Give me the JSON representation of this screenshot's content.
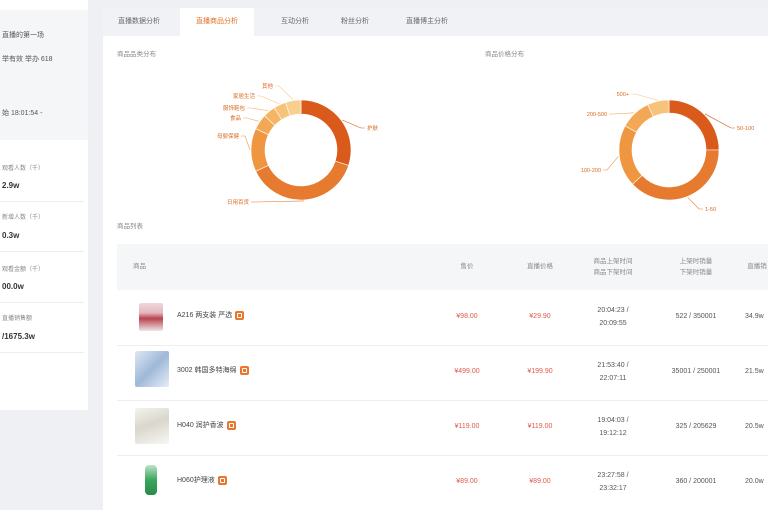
{
  "left_panel": {
    "lines": [
      "直播的第一场",
      "举有效 举办 618",
      "始 18:01:54 -"
    ],
    "stats": [
      {
        "label": "观看人数（千）",
        "value": "2.9w"
      },
      {
        "label": "新增人数（千）",
        "value": "0.3w"
      },
      {
        "label": "观看金额（千）",
        "value": "00.0w"
      },
      {
        "label": "直播销售额",
        "value": "/1675.3w"
      }
    ]
  },
  "tabs": [
    {
      "label": "直播数据分析"
    },
    {
      "label": "直播商品分析",
      "active": true
    },
    {
      "label": "互动分析"
    },
    {
      "label": "粉丝分析"
    },
    {
      "label": "直播博主分析"
    }
  ],
  "sections": {
    "category_chart_title": "商品品类分布",
    "price_chart_title": "商品价格分布",
    "product_list_title": "商品列表"
  },
  "charts": {
    "category": {
      "slices": [
        {
          "label": "护肤",
          "value": 30,
          "color": "#d95a1a"
        },
        {
          "label": "日用百货",
          "value": 38,
          "color": "#e67a2e"
        },
        {
          "label": "母婴保健",
          "value": 14,
          "color": "#ee9640"
        },
        {
          "label": "食品",
          "value": 5,
          "color": "#f2a855"
        },
        {
          "label": "服饰鞋包",
          "value": 4,
          "color": "#f5b565"
        },
        {
          "label": "家居生活",
          "value": 4,
          "color": "#f7c27a"
        },
        {
          "label": "其他",
          "value": 5,
          "color": "#f9cf90"
        }
      ]
    },
    "price": {
      "slices": [
        {
          "label": "50-100",
          "value": 25,
          "color": "#d95a1a"
        },
        {
          "label": "1-50",
          "value": 38,
          "color": "#e67a2e"
        },
        {
          "label": "100-200",
          "value": 20,
          "color": "#ee9640"
        },
        {
          "label": "200-500",
          "value": 10,
          "color": "#f2a855"
        },
        {
          "label": "500+",
          "value": 7,
          "color": "#f7c27a"
        }
      ]
    }
  },
  "table": {
    "headers": [
      "商品",
      "售价",
      "直播价格",
      "商品上架时间\n商品下架时间",
      "上架时销量\n下架时销量",
      "直播销"
    ],
    "rows": [
      {
        "name": "A216 两支装 严选",
        "price": "¥98.00",
        "live_price": "¥29.90",
        "time_on": "20:04:23 /",
        "time_off": "20:09:55",
        "sales": "522 / 350001",
        "extra": "34.9w"
      },
      {
        "name": "3002 韩国多特海绵",
        "price": "¥499.00",
        "live_price": "¥199.90",
        "time_on": "21:53:40 /",
        "time_off": "22:07:11",
        "sales": "35001 / 250001",
        "extra": "21.5w"
      },
      {
        "name": "H040 润护香波",
        "price": "¥119.00",
        "live_price": "¥119.00",
        "time_on": "19:04:03 /",
        "time_off": "19:12:12",
        "sales": "325 / 205629",
        "extra": "20.5w"
      },
      {
        "name": "H060护理液",
        "price": "¥89.00",
        "live_price": "¥89.00",
        "time_on": "23:27:58 /",
        "time_off": "23:32:17",
        "sales": "360 / 200001",
        "extra": "20.0w"
      }
    ]
  }
}
